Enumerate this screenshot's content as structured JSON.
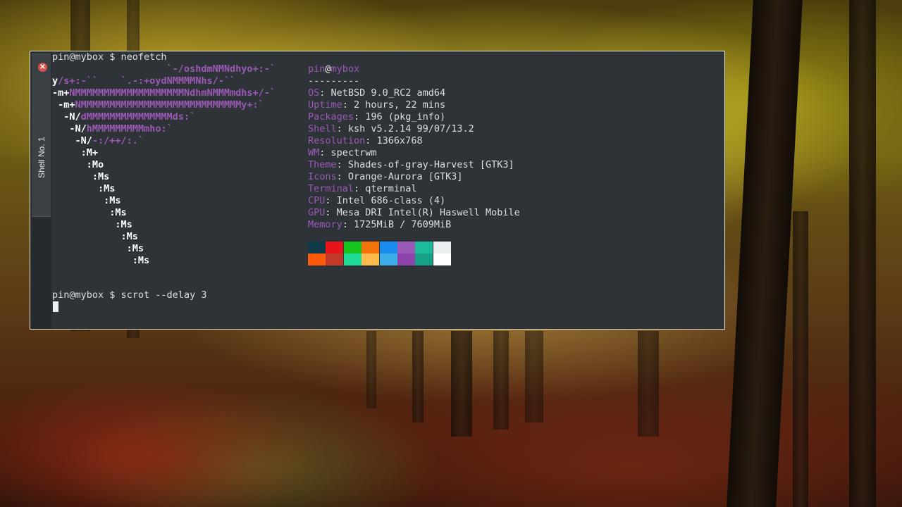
{
  "terminal": {
    "tab_label": "Shell No. 1",
    "close_icon": "close-icon",
    "cmd1": "pin@mybox $ neofetch",
    "cmd2": "pin@mybox $ scrot --delay 3",
    "logo": [
      {
        "w": "",
        "p": "                    `-/oshdmNMNdhyo+:-`"
      },
      {
        "w": "y",
        "p": "/s+:-``    `.-:+oydNMMMMNhs/-``"
      },
      {
        "w": "-m+",
        "p": "NMMMMMMMMMMMMMMMMMMMNdhmNMMMmdhs+/-`"
      },
      {
        "w": " -m+",
        "p": "NMMMMMMMMMMMMMMMMMMMMMMMMMMMMy+:`"
      },
      {
        "w": "  -N/",
        "p": "dMMMMMMMMMMMMMMMds:`"
      },
      {
        "w": "   -N/",
        "p": "hMMMMMMMMMmho:`"
      },
      {
        "w": "    -N/",
        "p": "-:/++/:.`"
      },
      {
        "w": "     :M+",
        "p": ""
      },
      {
        "w": "      :Mo",
        "p": ""
      },
      {
        "w": "       :Ms",
        "p": ""
      },
      {
        "w": "        :Ms",
        "p": ""
      },
      {
        "w": "         :Ms",
        "p": ""
      },
      {
        "w": "          :Ms",
        "p": ""
      },
      {
        "w": "           :Ms",
        "p": ""
      },
      {
        "w": "            :Ms",
        "p": ""
      },
      {
        "w": "             :Ms",
        "p": ""
      },
      {
        "w": "              :Ms",
        "p": ""
      }
    ],
    "info": {
      "user": "pin",
      "at": "@",
      "host": "mybox",
      "underline": "---------",
      "rows": [
        {
          "key": "OS",
          "value": "NetBSD 9.0_RC2 amd64"
        },
        {
          "key": "Uptime",
          "value": "2 hours, 22 mins"
        },
        {
          "key": "Packages",
          "value": "196 (pkg_info)"
        },
        {
          "key": "Shell",
          "value": "ksh v5.2.14 99/07/13.2"
        },
        {
          "key": "Resolution",
          "value": "1366x768"
        },
        {
          "key": "WM",
          "value": "spectrwm"
        },
        {
          "key": "Theme",
          "value": "Shades-of-gray-Harvest [GTK3]"
        },
        {
          "key": "Icons",
          "value": "Orange-Aurora [GTK3]"
        },
        {
          "key": "Terminal",
          "value": "qterminal"
        },
        {
          "key": "CPU",
          "value": "Intel 686-class (4)"
        },
        {
          "key": "GPU",
          "value": "Mesa DRI Intel(R) Haswell Mobile"
        },
        {
          "key": "Memory",
          "value": "1725MiB / 7609MiB"
        }
      ]
    },
    "palette": {
      "row1": [
        "#0f3a4a",
        "#e8141c",
        "#15c41d",
        "#f5720a",
        "#1a8cf0",
        "#9b59b6",
        "#1abc9c",
        "#eceff0"
      ],
      "row2": [
        "#fc5a0a",
        "#c0392b",
        "#1edc96",
        "#fdbc4b",
        "#3daee9",
        "#8e44ad",
        "#16a085",
        "#ffffff"
      ]
    }
  }
}
